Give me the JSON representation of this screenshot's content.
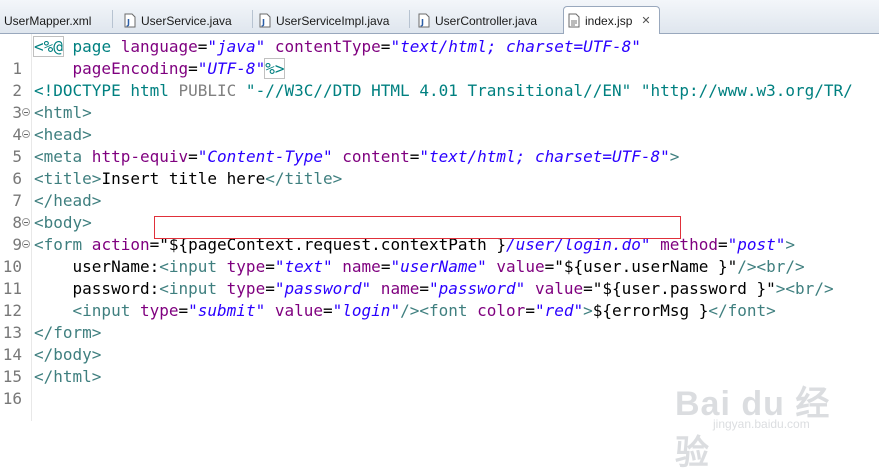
{
  "tabs": [
    {
      "label": "UserMapper.xml",
      "icon": "xml-file-icon",
      "active": false
    },
    {
      "label": "UserService.java",
      "icon": "java-file-icon",
      "active": false
    },
    {
      "label": "UserServiceImpl.java",
      "icon": "java-file-icon",
      "active": false
    },
    {
      "label": "UserController.java",
      "icon": "java-file-icon",
      "active": false
    },
    {
      "label": "index.jsp",
      "icon": "jsp-file-icon",
      "active": true,
      "close": "✕"
    }
  ],
  "line_numbers": [
    "1",
    "2",
    "3",
    "4",
    "5",
    "6",
    "7",
    "8",
    "9",
    "10",
    "11",
    "12",
    "13",
    "14",
    "15",
    "16"
  ],
  "code": {
    "l1": {
      "open": "<%@",
      "page": " page ",
      "lang_attr": "language",
      "eq1": "=",
      "lang_val": "\"java\"",
      "ct_attr": " contentType",
      "eq2": "=",
      "ct_val": "\"text/html; charset=UTF-8\""
    },
    "l2": {
      "indent": "    ",
      "pe_attr": "pageEncoding",
      "eq": "=",
      "pe_val": "\"UTF-8\"",
      "close": "%>"
    },
    "l3": {
      "doctype": "<!DOCTYPE html ",
      "public": "PUBLIC",
      "rest": " \"-//W3C//DTD HTML 4.01 Transitional//EN\" \"http://www.w3.org/TR/"
    },
    "l4": {
      "tag": "<html>"
    },
    "l5": {
      "tag": "<head>"
    },
    "l6": {
      "open": "<meta",
      "he_attr": " http-equiv",
      "eq1": "=",
      "he_val": "\"Content-Type\"",
      "c_attr": " content",
      "eq2": "=",
      "c_val": "\"text/html; charset=UTF-8\"",
      "close": ">"
    },
    "l7": {
      "open": "<title>",
      "text": "Insert title here",
      "close": "</title>"
    },
    "l8": {
      "tag": "</head>"
    },
    "l9": {
      "tag": "<body>"
    },
    "l10": {
      "open": "<form",
      "act_attr": " action",
      "eq1": "=",
      "act_el": "\"${pageContext.request.contextPath }",
      "act_val": "/user/login.do\"",
      "m_attr": " method",
      "eq2": "=",
      "m_val": "\"post\"",
      "close": ">"
    },
    "l11": {
      "indent": "    ",
      "label": "userName:",
      "open": "<input",
      "t_attr": " type",
      "eq1": "=",
      "t_val": "\"text\"",
      "n_attr": " name",
      "eq2": "=",
      "n_val": "\"userName\"",
      "v_attr": " value",
      "eq3": "=",
      "v_el": "\"${user.userName }\"",
      "close": "/><br/>"
    },
    "l12": {
      "indent": "    ",
      "label": "password:",
      "open": "<input",
      "t_attr": " type",
      "eq1": "=",
      "t_val": "\"password\"",
      "n_attr": " name",
      "eq2": "=",
      "n_val": "\"password\"",
      "v_attr": " value",
      "eq3": "=",
      "v_el": "\"${user.password }\"",
      "close": "><br/>"
    },
    "l13": {
      "indent": "    ",
      "open": "<input",
      "t_attr": " type",
      "eq1": "=",
      "t_val": "\"submit\"",
      "v_attr": " value",
      "eq2": "=",
      "v_val": "\"login\"",
      "mid": "/><font",
      "c_attr": " color",
      "eq3": "=",
      "c_val": "\"red\"",
      "gt": ">",
      "el": "${errorMsg }",
      "close": "</font>"
    },
    "l14": {
      "tag": "</form>"
    },
    "l15": {
      "tag": "</body>"
    },
    "l16": {
      "tag": "</html>"
    }
  },
  "watermark": {
    "main": "Bai du 经验",
    "sub": "jingyan.baidu.com"
  }
}
